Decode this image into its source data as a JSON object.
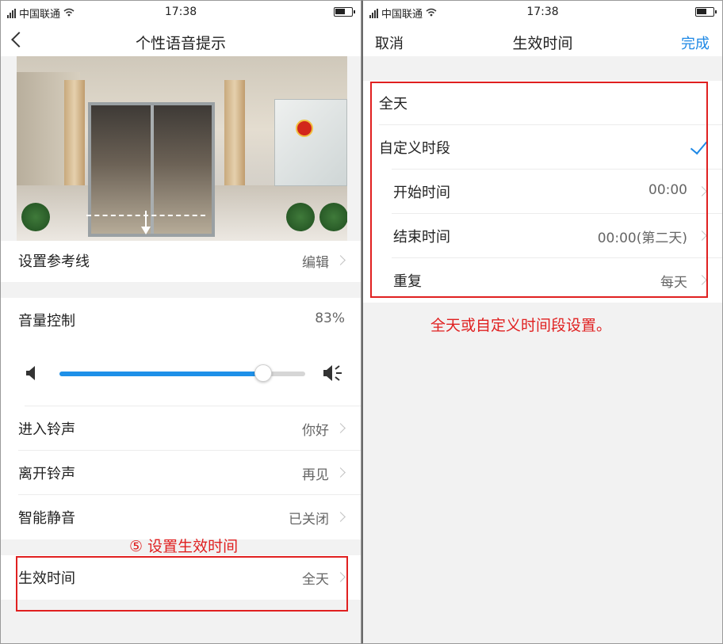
{
  "status_bar": {
    "carrier": "中国联通",
    "time": "17:38"
  },
  "left": {
    "title": "个性语音提示",
    "ref_line": {
      "label": "设置参考线",
      "value": "编辑"
    },
    "volume": {
      "label": "音量控制",
      "value_text": "83%",
      "level": 0.83
    },
    "enter_ring": {
      "label": "进入铃声",
      "value": "你好"
    },
    "leave_ring": {
      "label": "离开铃声",
      "value": "再见"
    },
    "smart_mute": {
      "label": "智能静音",
      "value": "已关闭"
    },
    "effective_time": {
      "label": "生效时间",
      "value": "全天"
    },
    "annotation": "⑤ 设置生效时间"
  },
  "right": {
    "cancel_label": "取消",
    "title": "生效时间",
    "done_label": "完成",
    "all_day": "全天",
    "custom": "自定义时段",
    "start": {
      "label": "开始时间",
      "value": "00:00"
    },
    "end": {
      "label": "结束时间",
      "value": "00:00(第二天)"
    },
    "repeat": {
      "label": "重复",
      "value": "每天"
    },
    "annotation": "全天或自定义时间段设置。"
  },
  "colors": {
    "accent": "#1e88e5",
    "annotation": "#e02020"
  },
  "icons": [
    "signal-icon",
    "wifi-icon",
    "battery-icon",
    "back-icon",
    "volume-low-icon",
    "volume-high-icon",
    "chevron-right-icon",
    "check-icon"
  ]
}
